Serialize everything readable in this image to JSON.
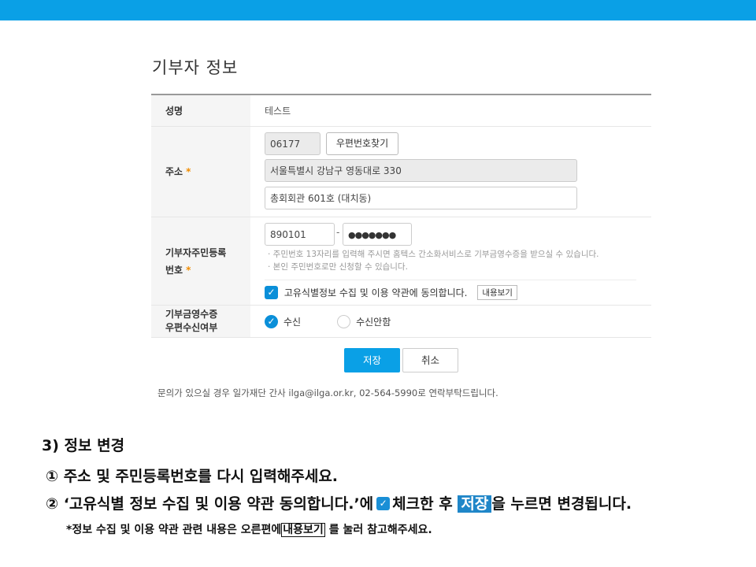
{
  "section_title": "기부자 정보",
  "form": {
    "name": {
      "label": "성명",
      "value": "테스트"
    },
    "address": {
      "label": "주소",
      "required_mark": "*",
      "postcode": "06177",
      "find_postcode_button": "우편번호찾기",
      "address1": "서울특별시 강남구 영동대로 330",
      "address2": "총회회관 601호 (대치동)"
    },
    "rrn": {
      "label_line1": "기부자주민등록",
      "label_line2": "번호",
      "required_mark": "*",
      "front": "890101",
      "dash": "-",
      "back": "●●●●●●●",
      "note1": "· 주민번호 13자리를 입력해 주시면 홈텍스 간소화서비스로 기부금영수증을 받으실 수 있습니다.",
      "note2": "· 본인 주민번호로만 신청할 수 있습니다.",
      "consent_text": "고유식별정보 수집 및 이용 약관에 동의합니다.",
      "consent_checked": true,
      "view_terms_button": "내용보기"
    },
    "receipt_mail": {
      "label_line1": "기부금영수증",
      "label_line2": "우편수신여부",
      "options": [
        {
          "label": "수신",
          "selected": true
        },
        {
          "label": "수신안함",
          "selected": false
        }
      ]
    }
  },
  "buttons": {
    "save": "저장",
    "cancel": "취소"
  },
  "contact_text": "문의가 있으실 경우 일가재단 간사 ilga@ilga.or.kr, 02-564-5990로 연락부탁드립니다.",
  "instructions": {
    "heading": "3) 정보 변경",
    "step1": "① 주소 및 주민등록번호를 다시 입력해주세요.",
    "step2_a": "② ‘고유식별 정보 수집 및 이용 약관 동의합니다.’에",
    "step2_b": "체크한 후",
    "step2_highlight": "저장",
    "step2_c": "을 누르면 변경됩니다.",
    "note_a": "*정보 수집 및 이용 약관 관련 내용은 오른편에",
    "note_boxed": "내용보기",
    "note_b": "를 눌러 참고해주세요."
  },
  "colors": {
    "accent": "#0aa0e6",
    "required": "#f08c00",
    "highlight": "#1f86c8"
  }
}
